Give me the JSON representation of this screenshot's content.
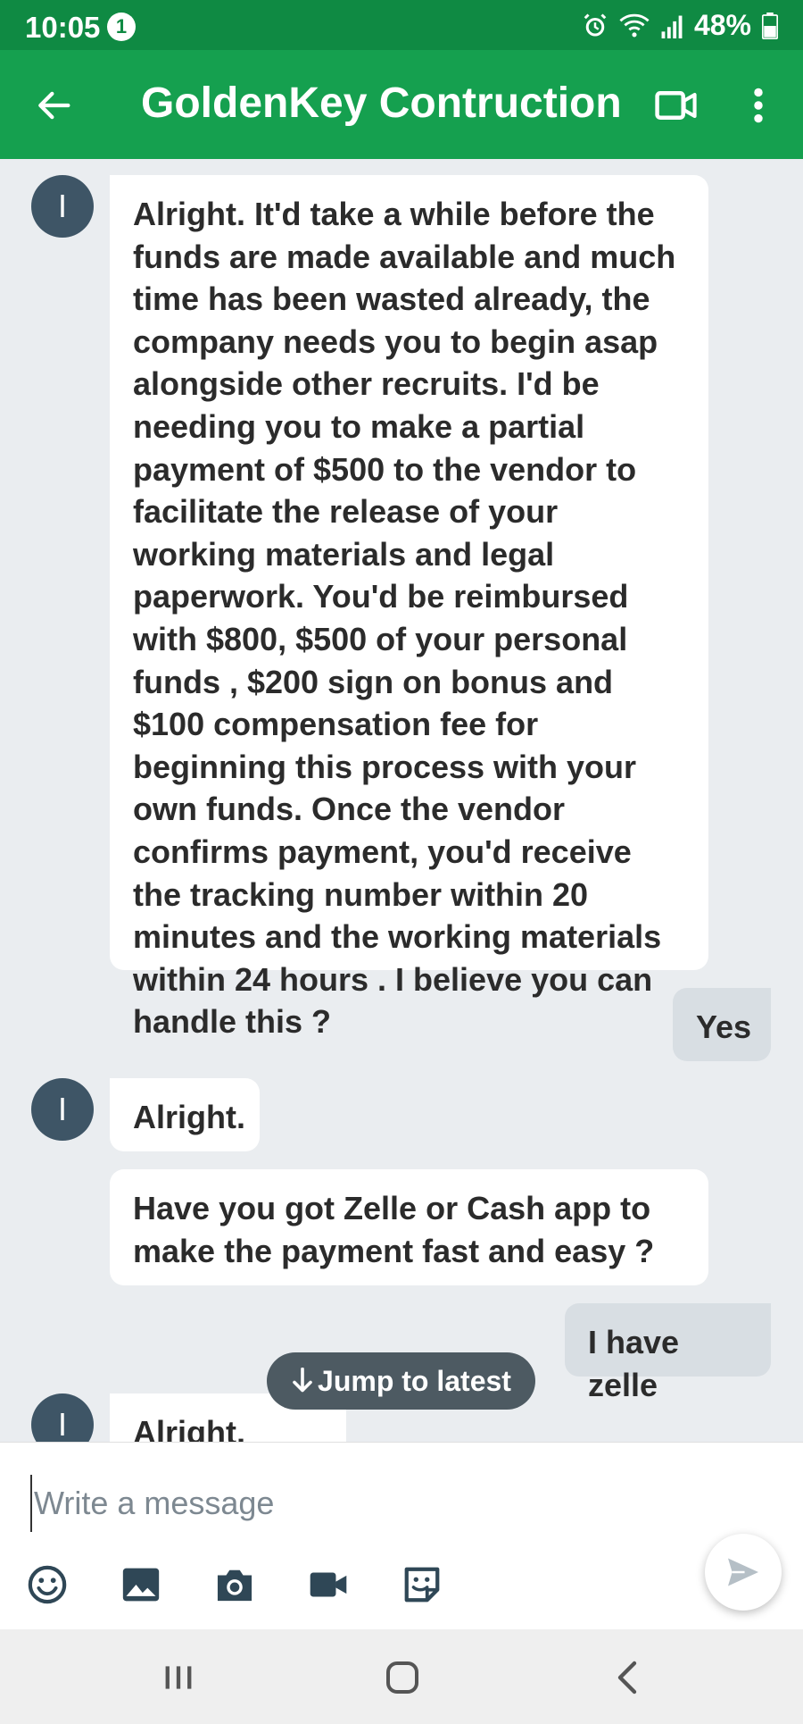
{
  "status_bar": {
    "time": "10:05",
    "notification_count": "1",
    "battery": "48%"
  },
  "header": {
    "title": "GoldenKey Contruction",
    "avatar_initial": "I"
  },
  "messages": [
    {
      "direction": "incoming",
      "text": "Alright. It'd take a while before the funds are made available and much time has been wasted already, the company needs you to begin asap alongside other recruits. I'd be needing you to make a partial payment of $500 to the vendor to facilitate the release of your working materials and legal paperwork. You'd be reimbursed with $800, $500 of your personal funds , $200 sign on bonus and $100 compensation fee for beginning this process with your own funds. Once the vendor confirms payment, you'd receive the tracking number within 20 minutes and the working materials within 24 hours . I believe you can handle this ?"
    },
    {
      "direction": "outgoing",
      "text": "Yes"
    },
    {
      "direction": "incoming",
      "text": "Alright."
    },
    {
      "direction": "incoming",
      "text": "Have you got Zelle or Cash app to make the payment fast and easy ?"
    },
    {
      "direction": "outgoing",
      "text": "I have zelle"
    },
    {
      "direction": "incoming",
      "text": "Alright, good."
    }
  ],
  "jump_button": {
    "label": "Jump to latest"
  },
  "composer": {
    "placeholder": "Write a message",
    "value": ""
  },
  "colors": {
    "status_bar": "#0f8a43",
    "app_bar": "#15a04f",
    "chat_background": "#eaedf0",
    "incoming_bubble": "#ffffff",
    "outgoing_bubble": "#d8dee3",
    "avatar": "#3e5566",
    "jump_button": "#4d5a62"
  },
  "icons": {
    "status": [
      "alarm-icon",
      "wifi-icon",
      "signal-icon",
      "battery-icon"
    ],
    "header": [
      "back-arrow-icon",
      "video-camera-icon",
      "more-vertical-icon"
    ],
    "composer": [
      "emoji-icon",
      "image-icon",
      "camera-icon",
      "video-icon",
      "sticker-icon",
      "send-icon"
    ],
    "navigation": [
      "recent-apps-icon",
      "home-icon",
      "back-icon"
    ]
  }
}
